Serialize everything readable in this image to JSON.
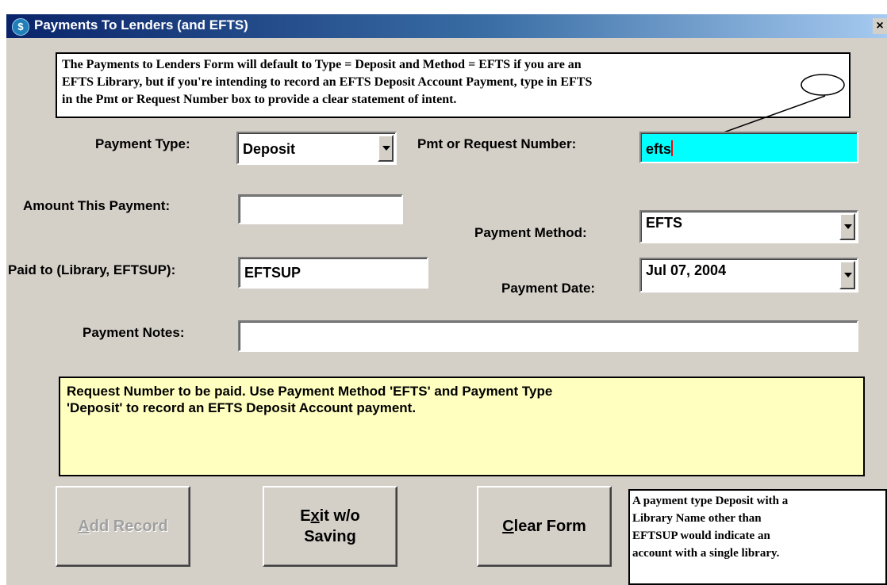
{
  "window": {
    "title": "Payments To Lenders (and EFTS)",
    "title_icon_glyph": "$",
    "close_glyph": "×"
  },
  "top_note": {
    "line1": "The Payments to Lenders Form will default to Type = Deposit and Method = EFTS if you are an",
    "line2": "EFTS Library, but if you're intending to record an EFTS Deposit Account Payment, type in EFTS",
    "line3": "in the Pmt or Request Number box to provide a clear statement of intent."
  },
  "form": {
    "payment_type_label": "Payment Type:",
    "payment_type_value": "Deposit",
    "pmt_request_label": "Pmt or Request Number:",
    "pmt_request_value": "efts",
    "amount_label": "Amount This Payment:",
    "amount_value": "",
    "payment_method_label": "Payment Method:",
    "payment_method_value": "EFTS",
    "paid_to_label": "Paid to (Library, EFTSUP):",
    "paid_to_value": "EFTSUP",
    "payment_date_label": "Payment Date:",
    "payment_date_value": "Jul 07, 2004",
    "notes_label": "Payment Notes:",
    "notes_value": ""
  },
  "hint": {
    "line1": "Request Number to be paid.  Use Payment Method 'EFTS' and Payment Type",
    "line2": "'Deposit' to record an EFTS Deposit Account payment."
  },
  "buttons": {
    "add_record": {
      "mnemonic": "A",
      "rest": "dd Record",
      "enabled": false
    },
    "exit": {
      "pre": "E",
      "mnemonic": "x",
      "post": "it w/o",
      "line2": "Saving"
    },
    "clear": {
      "mnemonic": "C",
      "rest": "lear Form"
    }
  },
  "side_note": {
    "line1": "A payment type Deposit with a",
    "line2": "Library Name other than",
    "line3": "EFTSUP would indicate an",
    "line4": "account with a single library."
  },
  "colors": {
    "form_bg": "#d4d0c8",
    "highlight_field": "#00ffff",
    "hint_bg": "#ffffc0",
    "title_gradient_start": "#0a246a"
  },
  "icons": {
    "title": "dollar-coin-icon",
    "close": "close-icon",
    "dropdown": "chevron-down-icon"
  }
}
